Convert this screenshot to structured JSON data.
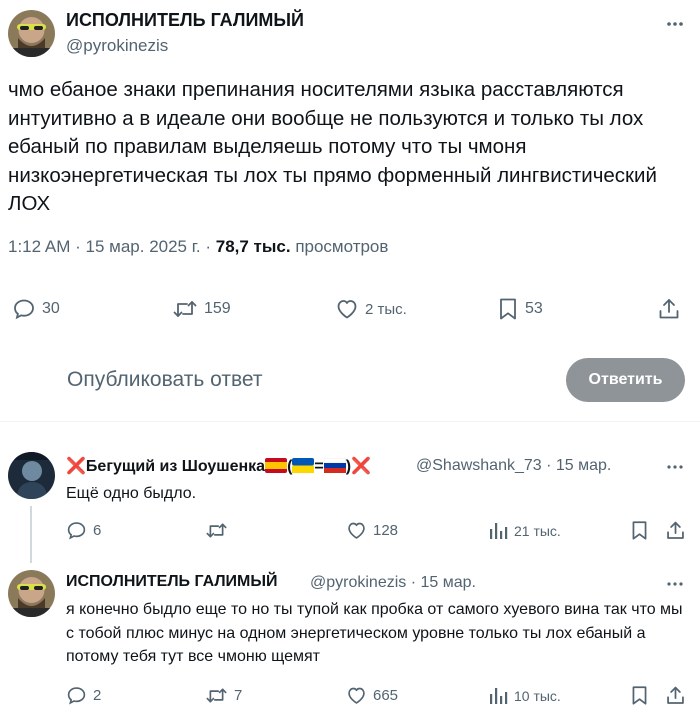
{
  "main_tweet": {
    "author_name": "ИСПОЛНИТЕЛЬ ГАЛИМЫЙ",
    "author_handle": "@pyrokinezis",
    "text": "чмо ебаное знаки препинания носителями языка расставляются интуитивно а в идеале они вообще не пользуются и только ты лох ебаный по правилам выделяешь потому что ты чмоня низкоэнергетическая ты лох ты прямо форменный лингвистический ЛОХ",
    "time": "1:12 AM",
    "date": "15 мар. 2025 г.",
    "views": "78,7 тыс.",
    "views_label": "просмотров",
    "replies": "30",
    "reposts": "159",
    "likes": "2 тыс.",
    "bookmarks": "53"
  },
  "compose": {
    "placeholder": "Опубликовать ответ",
    "button_label": "Ответить"
  },
  "replies": [
    {
      "name": "Бегущий из Шоушенка",
      "name_prefix": "❌",
      "name_suffix_open": "(",
      "name_equals": "=",
      "name_suffix_close": ")",
      "handle": "@Shawshank_73",
      "date": "15 мар.",
      "text": "Ещё одно быдло.",
      "replies": "6",
      "reposts": "",
      "likes": "128",
      "views": "21 тыс."
    },
    {
      "name": "ИСПОЛНИТЕЛЬ ГАЛИМЫЙ",
      "handle": "@pyrokinezis",
      "date": "15 мар.",
      "text": "я конечно быдло еще то но ты тупой как пробка от самого хуевого вина так что мы с тобой плюс минус на одном энергетическом уровне  только ты лох ебаный а потому тебя тут все чмоню щемят",
      "replies": "2",
      "reposts": "7",
      "likes": "665",
      "views": "10 тыс."
    }
  ],
  "separator": "·",
  "colors": {
    "text": "#0f1419",
    "secondary": "#536471",
    "button_disabled": "#8f9498",
    "divider": "#eff3f4",
    "cross_red": "#e0245e"
  },
  "icons": [
    "more-icon",
    "reply-icon",
    "repost-icon",
    "like-icon",
    "bookmark-icon",
    "share-icon",
    "views-icon"
  ]
}
